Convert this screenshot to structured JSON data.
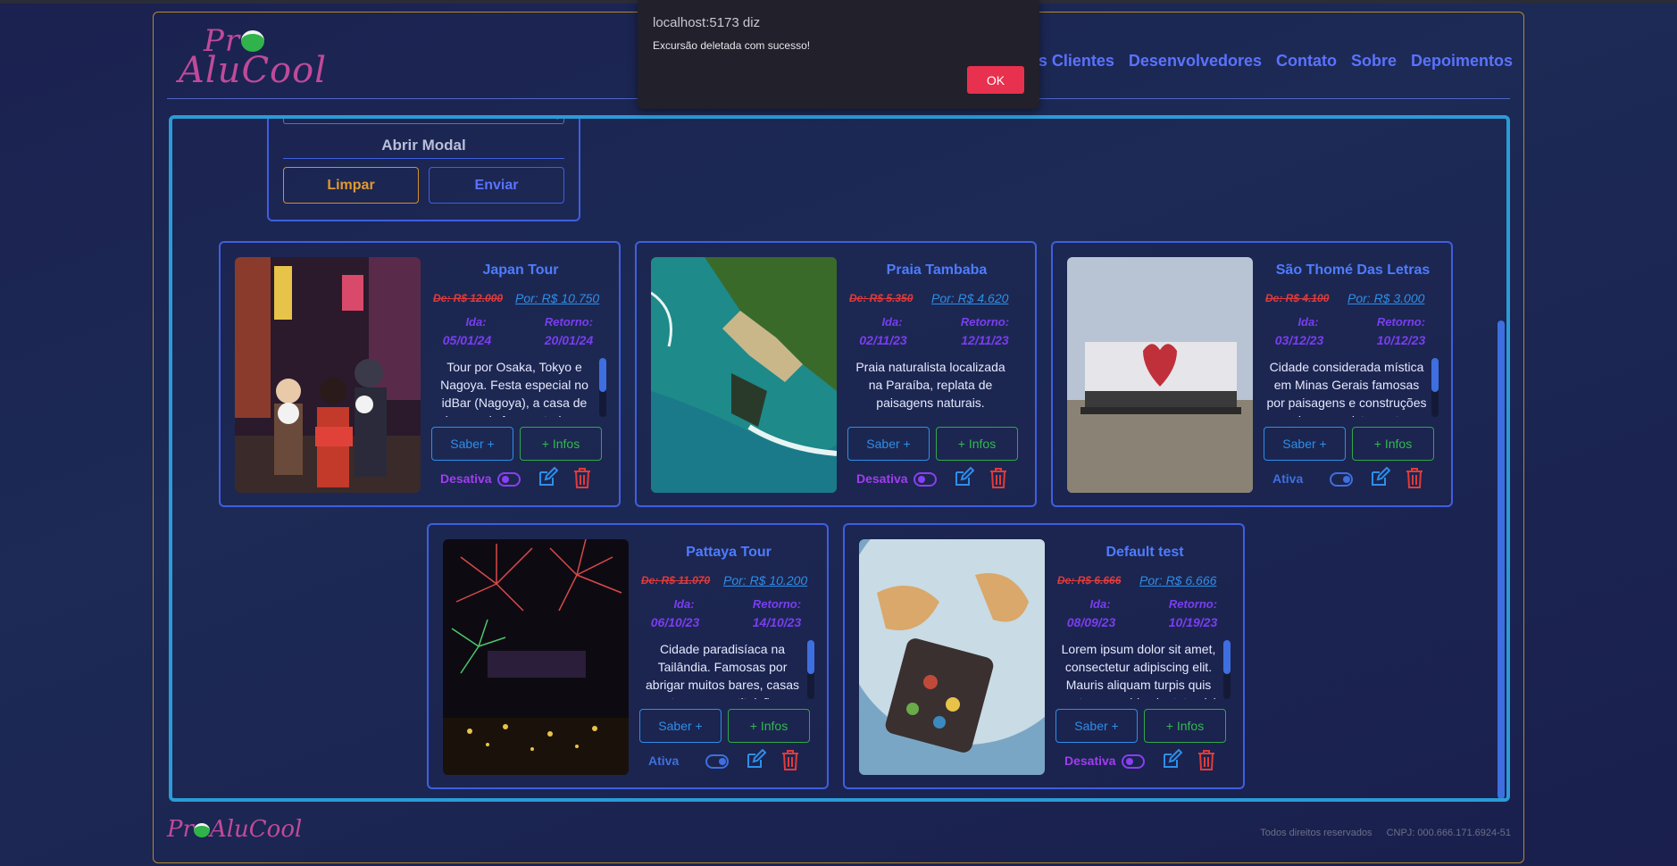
{
  "alert": {
    "title": "localhost:5173 diz",
    "message": "Excursão deletada com sucesso!",
    "ok_label": "OK"
  },
  "nav": {
    "items": [
      "síveis Clientes",
      "Desenvolvedores",
      "Contato",
      "Sobre",
      "Depoimentos"
    ]
  },
  "form": {
    "modal_label": "Abrir Modal",
    "clear_label": "Limpar",
    "submit_label": "Enviar"
  },
  "cards": [
    {
      "title": "Japan Tour",
      "de": "De: R$ 12.000",
      "por": "Por: R$ 10.750",
      "ida_label": "Ida:",
      "ida": "05/01/24",
      "retorno_label": "Retorno:",
      "retorno": "20/01/24",
      "description": "Tour por Osaka, Tokyo e Nagoya. Festa especial no idBar (Nagoya), a casa de show mais frequentada por",
      "saber_label": "Saber +",
      "infos_label": "+ Infos",
      "status": "Desativa",
      "active": false
    },
    {
      "title": "Praia Tambaba",
      "de": "De: R$ 5.350",
      "por": "Por: R$ 4.620",
      "ida_label": "Ida:",
      "ida": "02/11/23",
      "retorno_label": "Retorno:",
      "retorno": "12/11/23",
      "description": "Praia naturalista localizada na Paraíba, replata de paisagens naturais.",
      "saber_label": "Saber +",
      "infos_label": "+ Infos",
      "status": "Desativa",
      "active": false
    },
    {
      "title": "São Thomé Das Letras",
      "de": "De: R$ 4.100",
      "por": "Por: R$ 3.000",
      "ida_label": "Ida:",
      "ida": "03/12/23",
      "retorno_label": "Retorno:",
      "retorno": "10/12/23",
      "description": "Cidade considerada mística em Minas Gerais famosas por paisagens e construções rochosas, avistamentos",
      "saber_label": "Saber +",
      "infos_label": "+ Infos",
      "status": "Ativa",
      "active": true
    },
    {
      "title": "Pattaya Tour",
      "de": "De: R$ 11.070",
      "por": "Por: R$ 10.200",
      "ida_label": "Ida:",
      "ida": "06/10/23",
      "retorno_label": "Retorno:",
      "retorno": "14/10/23",
      "description": "Cidade paradisíaca na Tailândia. Famosas por abrigar muitos bares, casas noturnas, prostituição e",
      "saber_label": "Saber +",
      "infos_label": "+ Infos",
      "status": "Ativa",
      "active": true
    },
    {
      "title": "Default test",
      "de": "De: R$ 6.666",
      "por": "Por: R$ 6.666",
      "ida_label": "Ida:",
      "ida": "08/09/23",
      "retorno_label": "Retorno:",
      "retorno": "10/19/23",
      "description": "Lorem ipsum dolor sit amet, consectetur adipiscing elit. Mauris aliquam turpis quis erat cursus, id vulputate nisi",
      "saber_label": "Saber +",
      "infos_label": "+ Infos",
      "status": "Desativa",
      "active": false
    }
  ],
  "footer": {
    "rights": "Todos direitos reservados",
    "cnpj": "CNPJ: 000.666.171.6924-51"
  },
  "colors": {
    "accent_blue": "#3e5fe0",
    "delete_red": "#e03b3b",
    "ok_button": "#e7314f",
    "frame_gold": "#b58a2a"
  }
}
